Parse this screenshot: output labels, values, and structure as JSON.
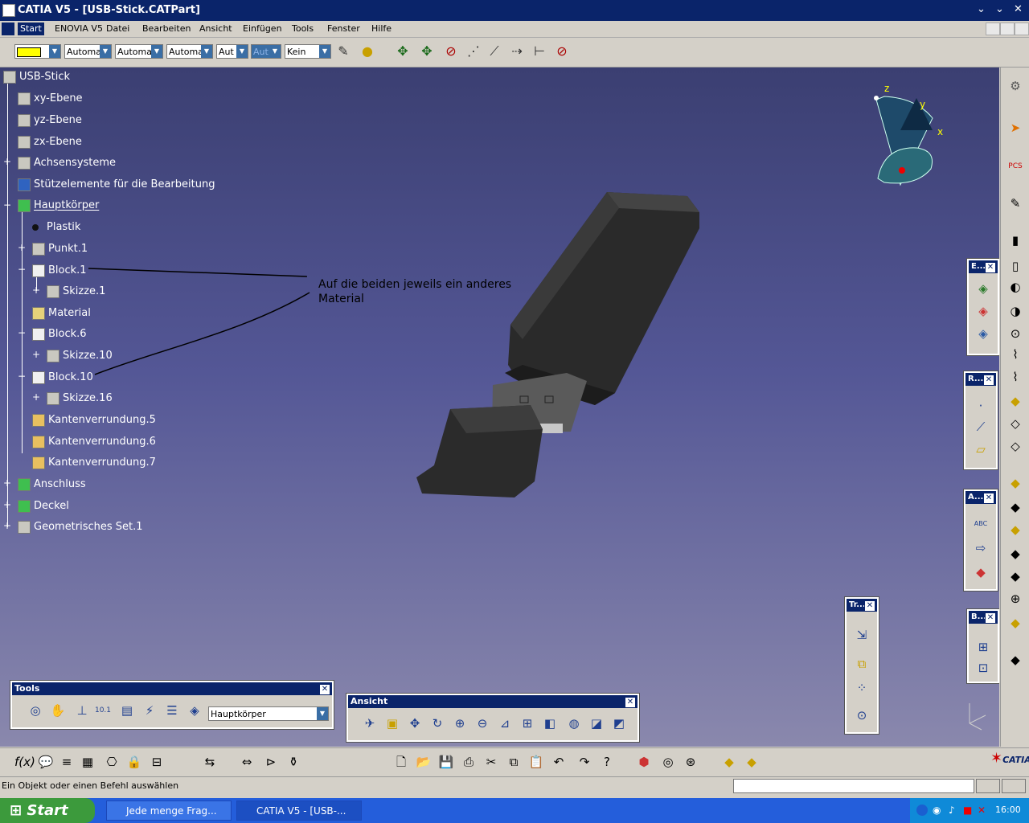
{
  "window": {
    "title": "CATIA V5 - [USB-Stick.CATPart]",
    "controls": [
      "⌄",
      "⌄",
      "✕"
    ]
  },
  "menu": {
    "items": [
      "Start",
      "ENOVIA V5",
      "Datei",
      "Bearbeiten",
      "Ansicht",
      "Einfügen",
      "Tools",
      "Fenster",
      "Hilfe"
    ]
  },
  "toolbar": {
    "combos": [
      "",
      "Automa",
      "Automa",
      "Automa",
      "Aut",
      "Aut",
      "Kein"
    ]
  },
  "tree": {
    "items": [
      {
        "label": "USB-Stick",
        "icon": "part-icon"
      },
      {
        "label": "xy-Ebene",
        "icon": "plane-icon"
      },
      {
        "label": "yz-Ebene",
        "icon": "plane-icon"
      },
      {
        "label": "zx-Ebene",
        "icon": "plane-icon"
      },
      {
        "label": "Achsensysteme",
        "icon": "axis-icon"
      },
      {
        "label": "Stützelemente für die Bearbeitung",
        "icon": "grid-icon"
      },
      {
        "label": "Hauptkörper",
        "icon": "body-icon"
      },
      {
        "label": "Plastik",
        "icon": "material-dot-icon"
      },
      {
        "label": "Punkt.1",
        "icon": "point-icon"
      },
      {
        "label": "Block.1",
        "icon": "pad-icon"
      },
      {
        "label": "Skizze.1",
        "icon": "sketch-icon"
      },
      {
        "label": "Material",
        "icon": "material-icon"
      },
      {
        "label": "Block.6",
        "icon": "pad-icon"
      },
      {
        "label": "Skizze.10",
        "icon": "sketch-icon"
      },
      {
        "label": "Block.10",
        "icon": "pad-icon"
      },
      {
        "label": "Skizze.16",
        "icon": "sketch-icon"
      },
      {
        "label": "Kantenverrundung.5",
        "icon": "fillet-icon"
      },
      {
        "label": "Kantenverrundung.6",
        "icon": "fillet-icon"
      },
      {
        "label": "Kantenverrundung.7",
        "icon": "fillet-icon"
      },
      {
        "label": "Anschluss",
        "icon": "body-icon"
      },
      {
        "label": "Deckel",
        "icon": "body-icon"
      },
      {
        "label": "Geometrisches Set.1",
        "icon": "geoset-icon"
      }
    ]
  },
  "annotation": {
    "text": "Auf die beiden jeweils ein anderes Material"
  },
  "compass": {
    "x": "x",
    "y": "y",
    "z": "z"
  },
  "panels": {
    "tools": {
      "title": "Tools",
      "body_combo": "Hauptkörper"
    },
    "ansicht": {
      "title": "Ansicht"
    },
    "e": {
      "title": "E..."
    },
    "r": {
      "title": "R..."
    },
    "a": {
      "title": "A..."
    },
    "tr": {
      "title": "Tr..."
    },
    "b": {
      "title": "B..."
    }
  },
  "status": {
    "text": "Ein Objekt oder einen Befehl auswählen"
  },
  "brand": {
    "logo_text": "CATIA"
  },
  "taskbar": {
    "start": "Start",
    "tasks": [
      "Jede menge Frag...",
      "CATIA V5 - [USB-..."
    ],
    "clock": "16:00"
  }
}
